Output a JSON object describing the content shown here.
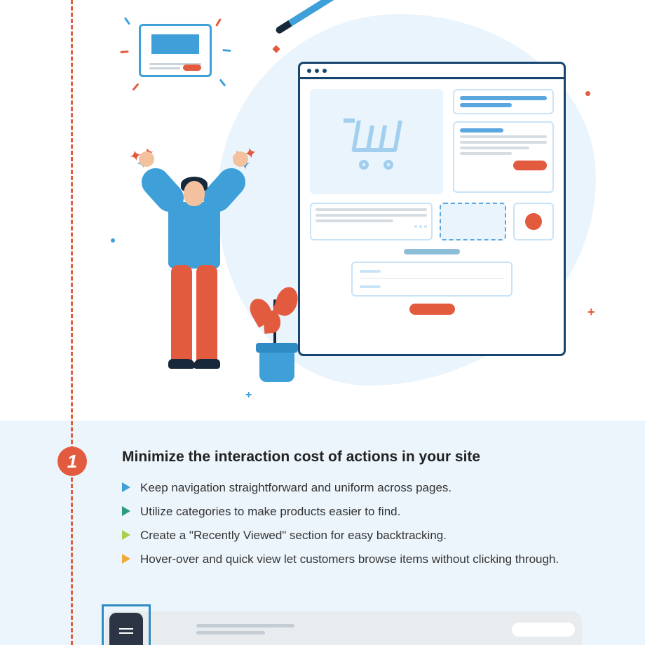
{
  "tip": {
    "number": "1",
    "title": "Minimize the interaction cost of actions in your site",
    "bullets": [
      {
        "color": "#3FA0D9",
        "text": "Keep navigation straightforward and uniform across pages."
      },
      {
        "color": "#2B9B84",
        "text": "Utilize categories to make products easier to find."
      },
      {
        "color": "#A9CF4F",
        "text": "Create a \"Recently Viewed\" section for easy backtracking."
      },
      {
        "color": "#F2A93B",
        "text": "Hover-over and quick view let customers browse items without clicking through."
      }
    ]
  }
}
